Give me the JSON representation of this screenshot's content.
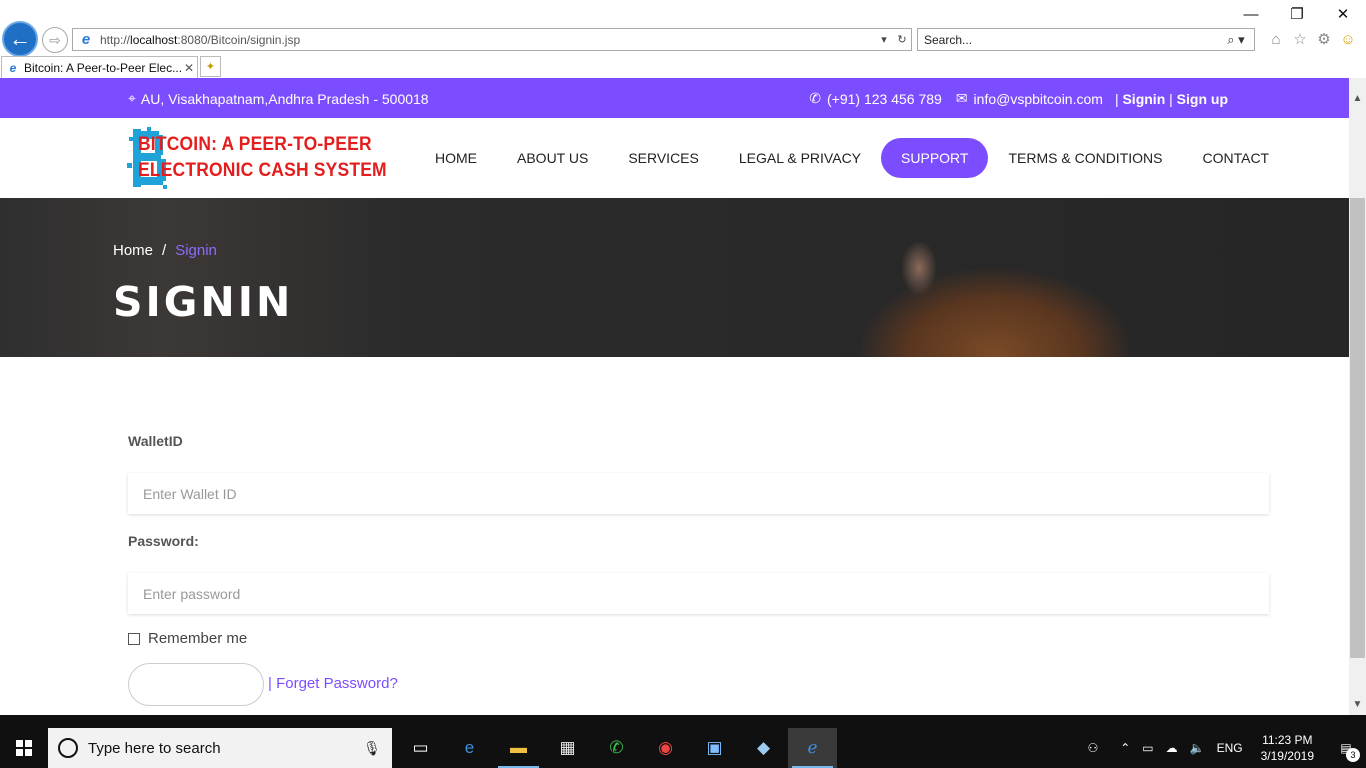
{
  "browser": {
    "url_prefix": "http://",
    "url_host": "localhost",
    "url_rest": ":8080/Bitcoin/signin.jsp",
    "search_placeholder": "Search...",
    "tab_title": "Bitcoin: A Peer-to-Peer Elec...",
    "win_minimize": "—",
    "win_restore": "❐",
    "win_close": "✕"
  },
  "topbar": {
    "address": "AU, Visakhapatnam,Andhra Pradesh - 500018",
    "phone": "(+91) 123 456 789",
    "email": "info@vspbitcoin.com",
    "sep": "|",
    "signin": "Signin",
    "signup": "Sign up"
  },
  "logo": {
    "line1": "BITCOIN: A PEER-TO-PEER",
    "line2": "ELECTRONIC CASH SYSTEM"
  },
  "menu": {
    "items": [
      "HOME",
      "ABOUT US",
      "SERVICES",
      "LEGAL & PRIVACY",
      "SUPPORT",
      "TERMS & CONDITIONS",
      "CONTACT"
    ],
    "active": "SUPPORT"
  },
  "hero": {
    "crumb_home": "Home",
    "crumb_sep": "/",
    "crumb_current": "Signin",
    "title": "SIGNIN"
  },
  "form": {
    "wallet_label": "WalletID",
    "wallet_placeholder": "Enter Wallet ID",
    "password_label": "Password:",
    "password_placeholder": "Enter password",
    "remember": "Remember me",
    "forgot": "| Forget Password?"
  },
  "taskbar": {
    "search_placeholder": "Type here to search",
    "lang": "ENG",
    "time": "11:23 PM",
    "date": "3/19/2019",
    "notif_count": "3"
  },
  "colors": {
    "accent": "#7c4dff",
    "logo_red": "#e41e1e",
    "logo_blue": "#1fa2d8"
  }
}
